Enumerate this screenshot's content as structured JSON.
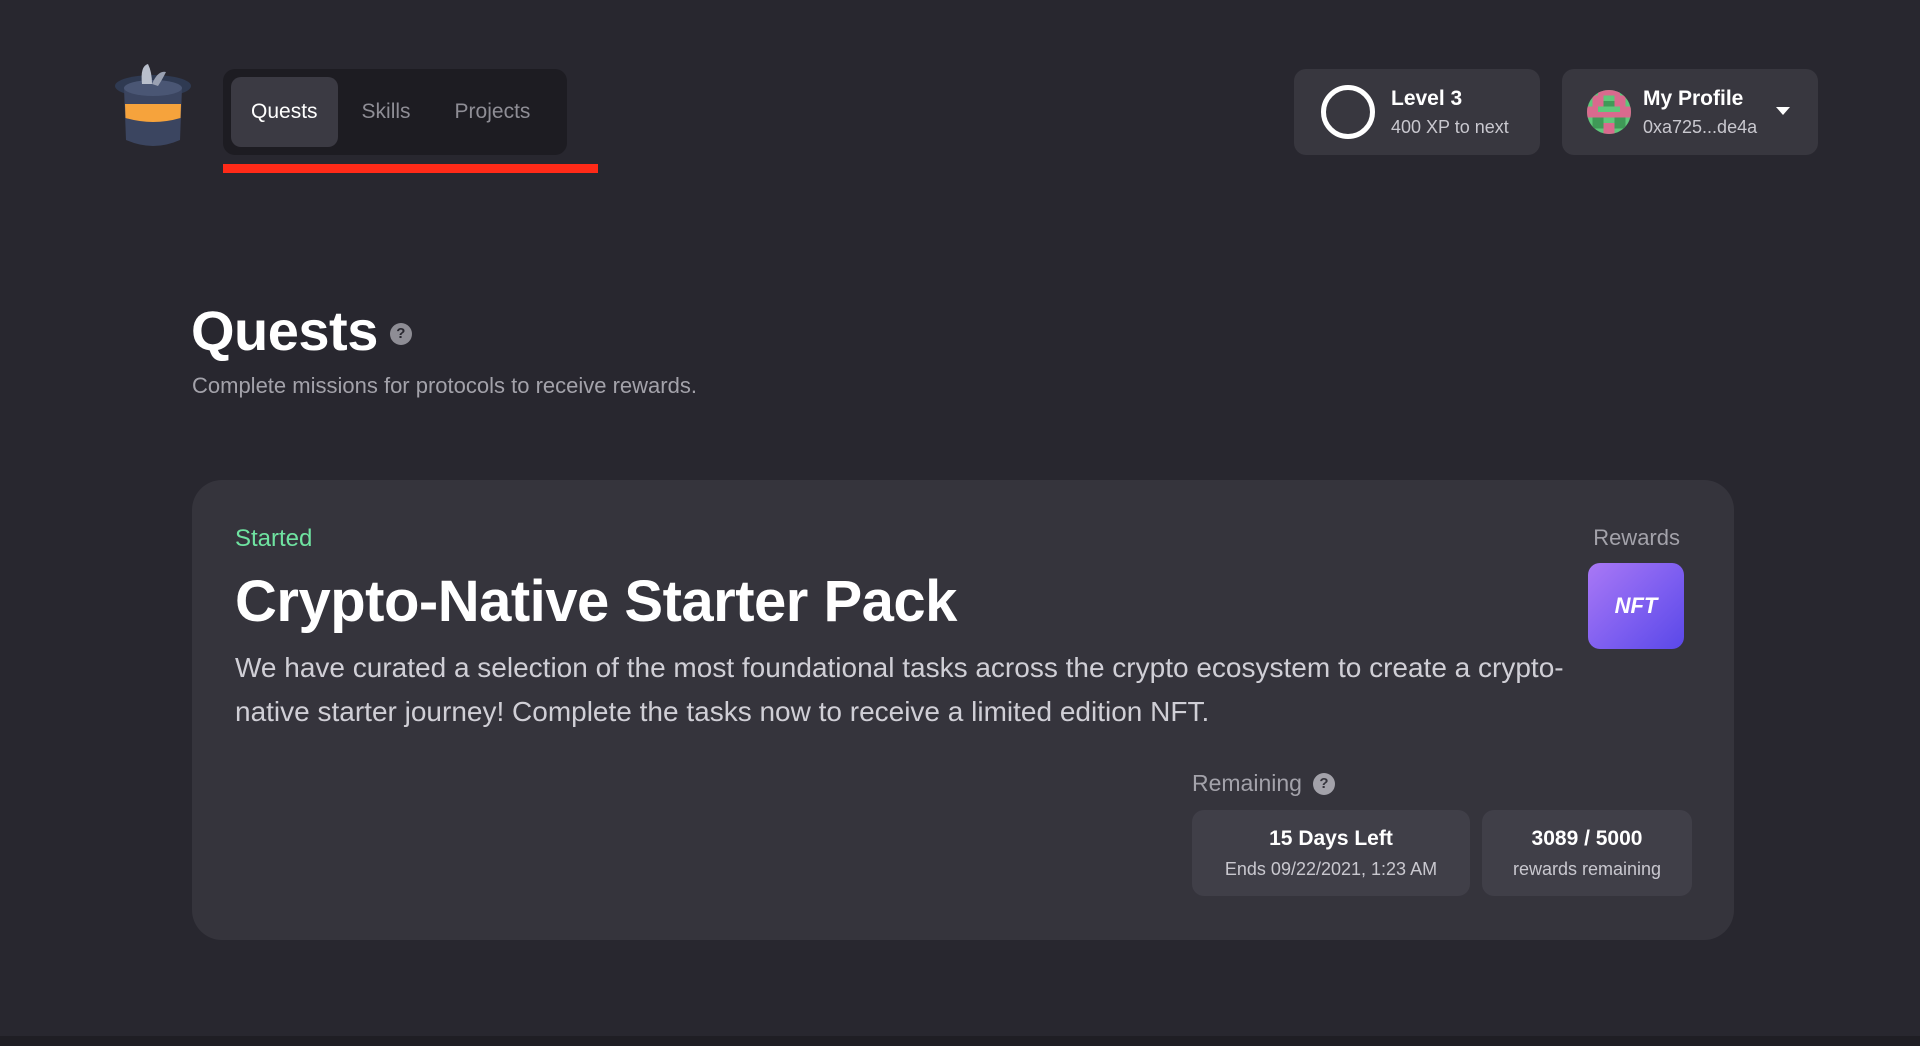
{
  "header": {
    "logo_icon": "magic-hat-icon",
    "tabs": [
      {
        "label": "Quests",
        "active": true
      },
      {
        "label": "Skills",
        "active": false
      },
      {
        "label": "Projects",
        "active": false
      }
    ],
    "level": {
      "title": "Level 3",
      "subtitle": "400 XP to next"
    },
    "profile": {
      "name": "My Profile",
      "address": "0xa725...de4a",
      "caret_icon": "chevron-down-icon"
    }
  },
  "page": {
    "title": "Quests",
    "help_glyph": "?",
    "subtitle": "Complete missions for protocols to receive rewards."
  },
  "quest": {
    "status": "Started",
    "title": "Crypto-Native Starter Pack",
    "description": "We have curated a selection of the most foundational tasks across the crypto ecosystem to create a crypto-native starter journey! Complete the tasks now to receive a limited edition NFT.",
    "rewards_label": "Rewards",
    "reward_badge": "NFT",
    "remaining_label": "Remaining",
    "remaining_help_glyph": "?",
    "time_left": "15 Days Left",
    "ends": "Ends 09/22/2021, 1:23 AM",
    "rewards_count": "3089 / 5000",
    "rewards_count_label": "rewards remaining"
  },
  "colors": {
    "background": "#28272f",
    "status_green": "#6fe3a1",
    "active_underline": "#ff2a18",
    "nft_gradient_start": "#a978f5",
    "nft_gradient_end": "#5a48e8"
  }
}
